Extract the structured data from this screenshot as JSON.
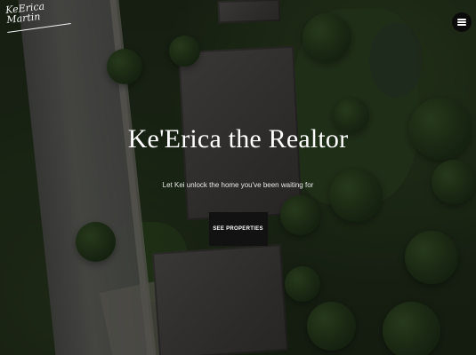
{
  "logo": {
    "text": "KeErica Martin"
  },
  "header": {
    "menu_icon": "hamburger-menu-icon"
  },
  "hero": {
    "title": "Ke'Erica the Realtor",
    "subtitle": "Let Kei unlock the home you've been waiting for",
    "cta_label": "SEE PROPERTIES"
  },
  "colors": {
    "cta_bg": "#121212",
    "menu_bg": "#0b0b0b",
    "text": "#ffffff"
  }
}
